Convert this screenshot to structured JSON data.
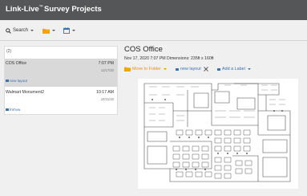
{
  "header": {
    "brand": "Link-Live",
    "brand_mark": "™",
    "title": "Survey Projects"
  },
  "toolbar": {
    "search_label": "Search"
  },
  "project_list": {
    "count": "(2)",
    "items": [
      {
        "name": "COS Office",
        "time": "7:07 PM",
        "date": "11/17/20",
        "tag": "new layout",
        "selected": true
      },
      {
        "name": "Walmart Monument2",
        "time": "10:17 AM",
        "date": "10/31/20",
        "tag": "fmhvw",
        "selected": false
      }
    ]
  },
  "detail": {
    "title": "COS Office",
    "meta": "Nov 17, 2020 7:07 PM Dimensions: 235ft x 160ft",
    "move_to_folder": "Move to Folder",
    "layout_tag": "new layout",
    "add_label": "Add a Label"
  },
  "colors": {
    "header_bg": "#555657",
    "accent_orange": "#e59500",
    "accent_blue": "#3b6fb0",
    "selected_row": "#d9d9d9"
  },
  "icons": [
    "search-icon",
    "folder-icon",
    "calendar-icon",
    "tag-icon",
    "close-icon",
    "chevron-down-icon"
  ]
}
